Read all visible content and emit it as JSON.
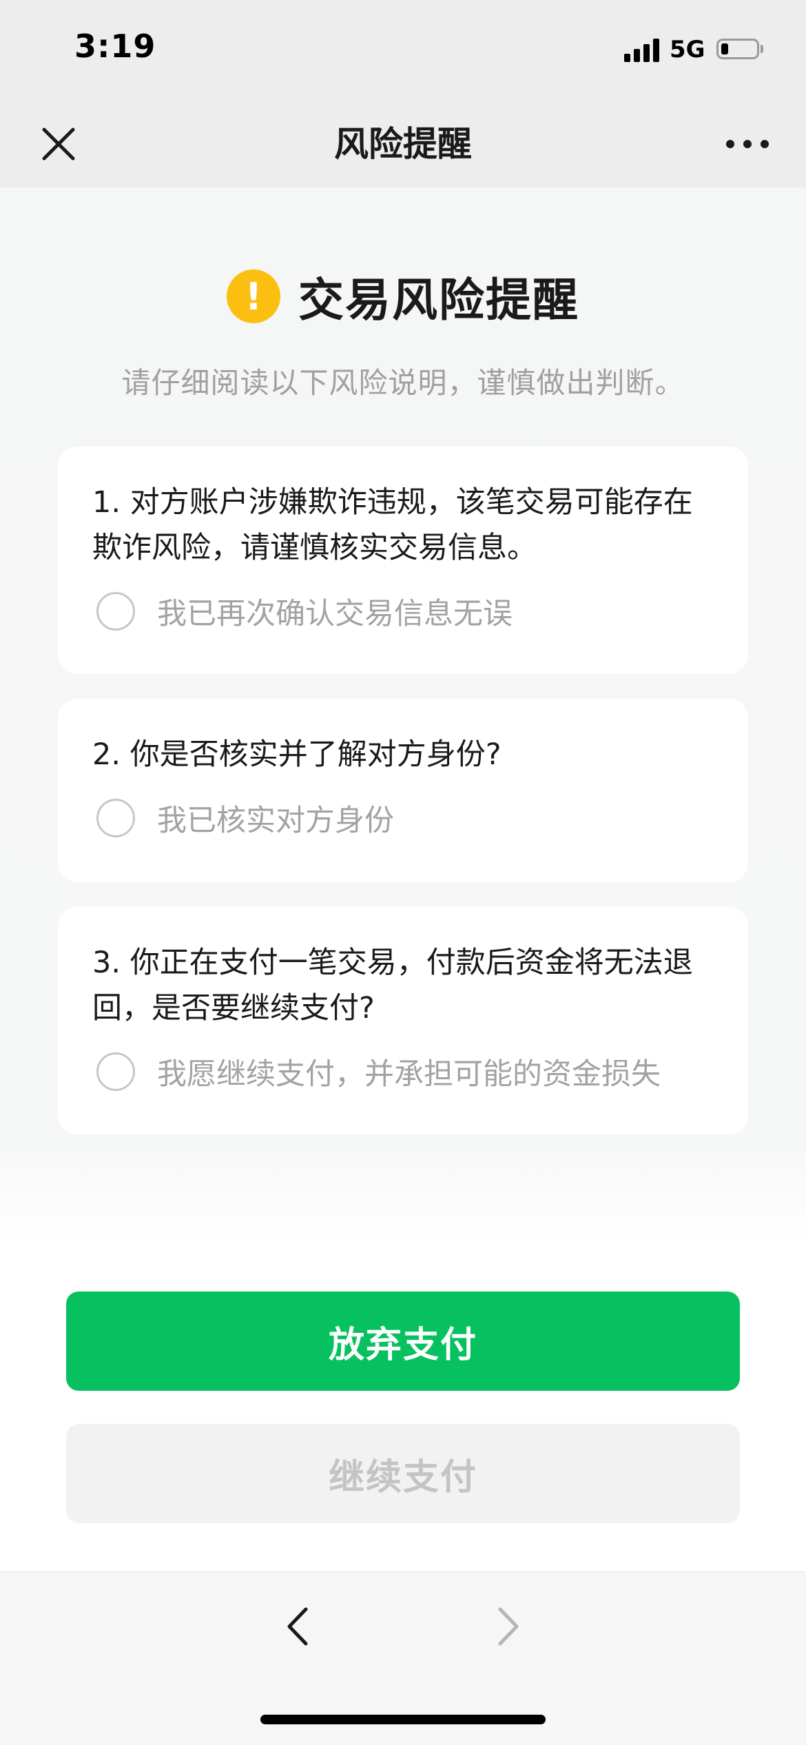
{
  "status_bar": {
    "time": "3:19",
    "network": "5G"
  },
  "nav": {
    "title": "风险提醒",
    "close_icon": "close-icon",
    "more_icon": "more-icon"
  },
  "heading": {
    "icon": "warning-icon",
    "icon_symbol": "!",
    "title": "交易风险提醒",
    "subtitle": "请仔细阅读以下风险说明，谨慎做出判断。"
  },
  "cards": [
    {
      "question": "1. 对方账户涉嫌欺诈违规，该笔交易可能存在欺诈风险，请谨慎核实交易信息。",
      "option": "我已再次确认交易信息无误",
      "checked": false
    },
    {
      "question": "2. 你是否核实并了解对方身份?",
      "option": "我已核实对方身份",
      "checked": false
    },
    {
      "question": "3. 你正在支付一笔交易，付款后资金将无法退回，是否要继续支付?",
      "option": "我愿继续支付，并承担可能的资金损失",
      "checked": false
    }
  ],
  "buttons": {
    "abandon": "放弃支付",
    "continue": "继续支付"
  },
  "colors": {
    "accent_green": "#07c160",
    "warning_yellow": "#fbbf12",
    "disabled_text": "#c4c4c4"
  },
  "toolbar": {
    "back_icon": "chevron-left-icon",
    "forward_icon": "chevron-right-icon"
  }
}
